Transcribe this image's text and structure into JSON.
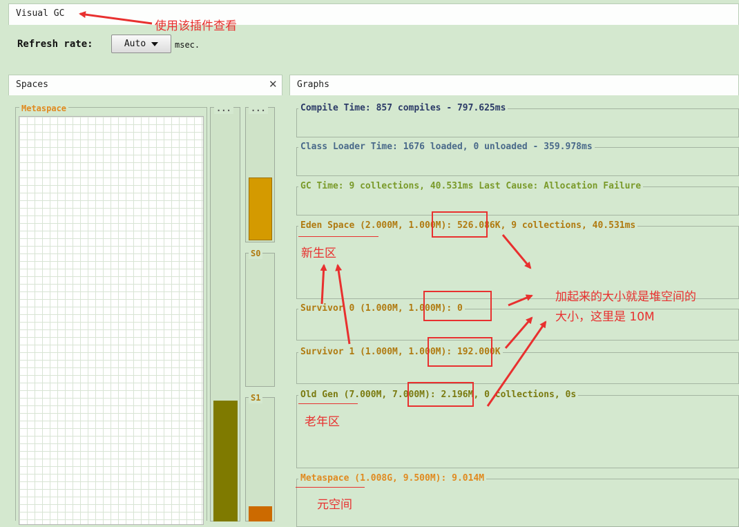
{
  "window_title": "Visual GC",
  "refresh": {
    "label": "Refresh rate:",
    "value": "Auto",
    "unit": "msec."
  },
  "spaces_panel": {
    "title": "Spaces",
    "close_glyph": "✕",
    "metaspace_label": "Metaspace",
    "col1_label": "...",
    "col2_label": "...",
    "s0_label": "S0",
    "s1_label": "S1"
  },
  "graphs_panel": {
    "title": "Graphs",
    "graphs": [
      {
        "id": "compile",
        "text": "Compile Time: 857 compiles - 797.625ms",
        "color": "#2b3a67"
      },
      {
        "id": "classloader",
        "text": "Class Loader Time: 1676 loaded, 0 unloaded - 359.978ms",
        "color": "#4a6a8a"
      },
      {
        "id": "gc",
        "text": "GC Time: 9 collections, 40.531ms Last Cause: Allocation Failure",
        "color": "#7a9a2a"
      },
      {
        "id": "eden",
        "text": "Eden Space (2.000M, 1.000M): 526.086K, 9 collections, 40.531ms",
        "color": "#b07a10"
      },
      {
        "id": "s0",
        "text": "Survivor 0 (1.000M, 1.000M): 0",
        "color": "#b07a10"
      },
      {
        "id": "s1",
        "text": "Survivor 1 (1.000M, 1.000M): 192.000K",
        "color": "#b07a10"
      },
      {
        "id": "old",
        "text": "Old Gen (7.000M, 7.000M): 2.196M, 0 collections, 0s",
        "color": "#7a7a10"
      },
      {
        "id": "meta",
        "text": "Metaspace (1.008G, 9.500M): 9.014M",
        "color": "#e08a20"
      }
    ]
  },
  "annotations": {
    "plugin_note": "使用该插件查看",
    "young_gen": "新生区",
    "old_gen": "老年区",
    "metaspace": "元空间",
    "heap_note_line1": "加起来的大小就是堆空间的",
    "heap_note_line2": "大小，这里是 10M"
  },
  "colors": {
    "bg": "#d4e8cf",
    "annotation_red": "#e8302f",
    "eden_bar": "#d49a00",
    "old_bar": "#7f7a00",
    "s1_bar": "#cc6a00"
  }
}
